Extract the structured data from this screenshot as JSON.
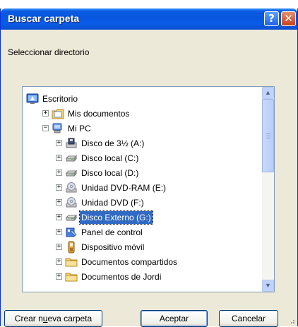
{
  "window": {
    "title": "Buscar carpeta",
    "help_symbol": "?",
    "close_symbol": "✕"
  },
  "dialog": {
    "instruction": "Seleccionar directorio"
  },
  "tree": {
    "items": [
      {
        "label": "Escritorio",
        "icon": "desktop-icon",
        "expander": ""
      },
      {
        "label": "Mis documentos",
        "icon": "my-documents-icon",
        "expander": "+"
      },
      {
        "label": "Mi PC",
        "icon": "my-computer-icon",
        "expander": "−"
      },
      {
        "label": "Disco de 3½ (A:)",
        "icon": "floppy-drive-icon",
        "expander": "+"
      },
      {
        "label": "Disco local (C:)",
        "icon": "hard-drive-icon",
        "expander": "+"
      },
      {
        "label": "Disco local (D:)",
        "icon": "hard-drive-icon",
        "expander": "+"
      },
      {
        "label": "Unidad DVD-RAM (E:)",
        "icon": "dvd-drive-icon",
        "expander": "+"
      },
      {
        "label": "Unidad DVD (F:)",
        "icon": "dvd-drive-icon",
        "expander": "+"
      },
      {
        "label": "Disco Externo (G:)",
        "icon": "hard-drive-icon",
        "expander": "+",
        "selected": true
      },
      {
        "label": "Panel de control",
        "icon": "control-panel-icon",
        "expander": "+"
      },
      {
        "label": "Dispositivo móvil",
        "icon": "mobile-device-icon",
        "expander": "+"
      },
      {
        "label": "Documentos compartidos",
        "icon": "folder-icon",
        "expander": "+"
      },
      {
        "label": "Documentos de Jordi",
        "icon": "folder-icon",
        "expander": "+"
      }
    ]
  },
  "buttons": {
    "new_folder_pre": "Crear n",
    "new_folder_key": "u",
    "new_folder_post": "eva carpeta",
    "accept": "Aceptar",
    "cancel": "Cancelar"
  },
  "colors": {
    "titlebar": "#0a5ce2",
    "dialog_bg": "#ece9d8",
    "selection": "#316ac5"
  }
}
